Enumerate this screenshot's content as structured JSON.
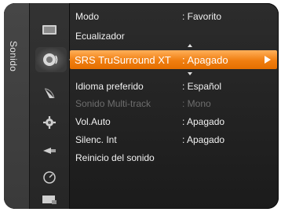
{
  "category_tab": {
    "label": "Sonido"
  },
  "categories": [
    {
      "icon": "picture-icon"
    },
    {
      "icon": "sound-icon",
      "active": true
    },
    {
      "icon": "channel-icon"
    },
    {
      "icon": "setup-icon"
    },
    {
      "icon": "input-icon"
    },
    {
      "icon": "application-icon"
    },
    {
      "icon": "support-icon"
    }
  ],
  "menu": {
    "items": [
      {
        "label": "Modo",
        "value": ": Favorito"
      },
      {
        "label": "Ecualizador",
        "value": ""
      },
      {
        "label": "SRS TruSurround XT",
        "value": ": Apagado",
        "selected": true
      },
      {
        "label": "Idioma preferido",
        "value": ": Español"
      },
      {
        "label": "Sonido Multi-track",
        "value": ": Mono",
        "disabled": true
      },
      {
        "label": "Vol.Auto",
        "value": ": Apagado"
      },
      {
        "label": "Silenc. Int",
        "value": ": Apagado"
      },
      {
        "label": "Reinicio del sonido",
        "value": ""
      }
    ]
  },
  "colors": {
    "highlight": "#f07e10",
    "panel": "#222222",
    "disabled_text": "#6e6e6e"
  }
}
